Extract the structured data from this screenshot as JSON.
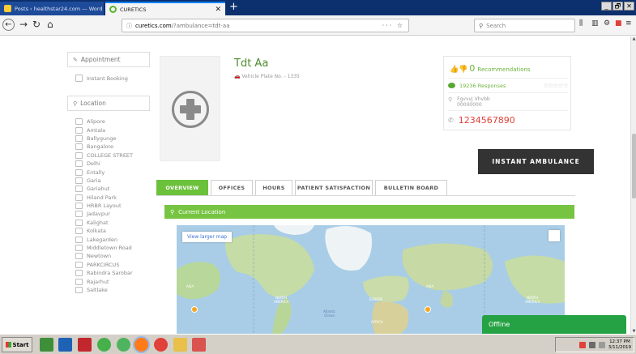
{
  "browser": {
    "tabs": [
      {
        "title": "Posts ‹ healthstar24.com — Word",
        "close": "✕"
      },
      {
        "title": "CURETICS",
        "close": "✕"
      }
    ],
    "new_tab": "+",
    "window_buttons": [
      "_",
      "🗗",
      "✕"
    ],
    "url_info_icon": "ⓘ",
    "url_site": "curetics.com",
    "url_path": "/?ambulance=tdt-aa",
    "url_actions": "··· ☆",
    "search_placeholder": "Search",
    "search_icon": "⚲",
    "toolbar_icons": [
      "library-icon",
      "sidebar-icon",
      "extension-icon",
      "pocket-icon",
      "menu-icon"
    ]
  },
  "sidebar": {
    "appointment_label": "Appointment",
    "instant_booking_label": "Instant Booking",
    "location_label": "Location",
    "locations": [
      "Alipore",
      "Amtala",
      "Ballygunge",
      "Bangalore",
      "COLLEGE STREET",
      "Delhi",
      "Entally",
      "Garia",
      "Gariahut",
      "Hiland Park",
      "HRBR Layout",
      "Jadavpur",
      "Kalighat",
      "Kolkata",
      "Lakegarden",
      "Middletown Road",
      "Newtown",
      "PARKCIRCUS",
      "Rabindra Sarobar",
      "Rajarhut",
      "Saltlake"
    ]
  },
  "profile": {
    "name": "Tdt Aa",
    "plate": "Vehicle Plate No. - 1335",
    "recommendations_count": "0",
    "recommendations_label": "Recommendations",
    "responses": "19236 Responses",
    "rating_stars": "☆☆☆☆☆",
    "address_line1": "Fgvvvj Vhvbb",
    "address_line2": "00000000",
    "phone": "1234567890",
    "instant_button": "INSTANT AMBULANCE"
  },
  "tabs": [
    "OVERVIEW",
    "OFFICES",
    "HOURS",
    "PATIENT SATISFACTION",
    "BULLETIN BOARD"
  ],
  "active_tab": "OVERVIEW",
  "section_title": "Current Location",
  "map": {
    "view_larger": "View larger map",
    "labels": {
      "asia_left": "ASIA",
      "north_america": "NORTH\nAMERICA",
      "atlantic": "Atlantic\nOcean",
      "europe": "EUROPE",
      "asia_right": "ASIA",
      "north_america_right": "NORTH\nAMERICA",
      "africa": "AFRICA"
    }
  },
  "chat_status": "Offline",
  "taskbar": {
    "start": "Start",
    "clock_time": "12:37 PM",
    "clock_date": "3/11/2019"
  },
  "colors": {
    "brand_green": "#6cc13b",
    "phone_red": "#e0413a",
    "offline_green": "#25a244"
  }
}
